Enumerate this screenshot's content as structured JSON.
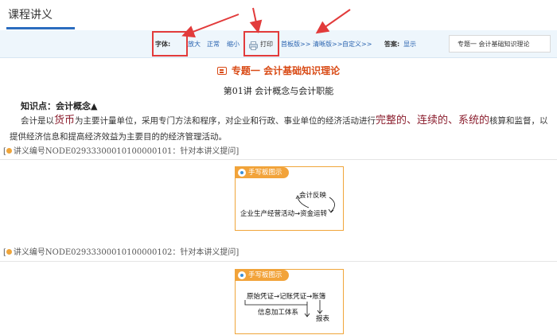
{
  "header": {
    "tab_title": "课程讲义"
  },
  "toolbar": {
    "font_label": "字体:",
    "enlarge": "放大",
    "normal": "正常",
    "shrink": "缩小",
    "print": "打印",
    "prev_version": "首板版>>",
    "new_version": "清晰版>>",
    "custom": "自定义>>",
    "answer_label": "答案:",
    "answer_value": "显示",
    "topic_box": "专题一    会计基础知识理论"
  },
  "content": {
    "topic_heading": "专题一   会计基础知识理论",
    "lecture_title": "第01讲    会计概念与会计职能",
    "knowledge_point": "知识点：会计概念▲",
    "para_1": "会计是以",
    "para_hl_1": "货币",
    "para_2": "为主要计量单位，采用专门方法和程序，对企业和行政、事业单位的经济活动进行",
    "para_hl_2": "完整的、连续的、系统的",
    "para_3": "核算和监督，以提供经济信息和提高经济效益为主要目的的经济管理活动。",
    "note_1": "讲义编号NODE02933300010100000101：针对本讲义提问]",
    "note_2": "讲义编号NODE02933300010100000102：针对本讲义提问]",
    "note_bracket": "["
  },
  "handwriting_1": {
    "tag": "手写板图示",
    "top_text": "会计反映",
    "bottom_text": "企业生产经营活动→资金运转"
  },
  "handwriting_2": {
    "tag": "手写板图示",
    "line_1": "原始凭证→记账凭证→账簿",
    "line_2": "信息加工体系",
    "line_3": "报表"
  },
  "colors": {
    "accent": "#2b6dbf",
    "heading": "#d94b16",
    "highlight": "#8b1e2e",
    "callout": "#e23b3b",
    "tag": "#f2a33a"
  }
}
